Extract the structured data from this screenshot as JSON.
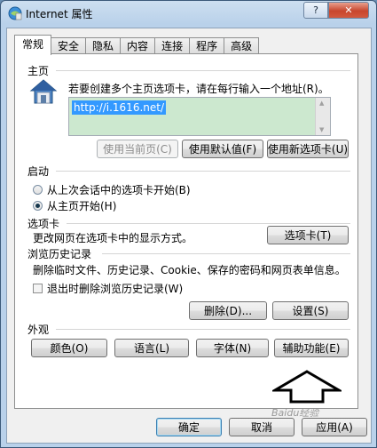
{
  "window": {
    "title": "Internet 属性",
    "help_label": "?",
    "close_label": "✕"
  },
  "tabs": [
    {
      "label": "常规"
    },
    {
      "label": "安全"
    },
    {
      "label": "隐私"
    },
    {
      "label": "内容"
    },
    {
      "label": "连接"
    },
    {
      "label": "程序"
    },
    {
      "label": "高级"
    }
  ],
  "homepage": {
    "title": "主页",
    "description": "若要创建多个主页选项卡，请在每行输入一个地址(R)。",
    "url": "http://i.1616.net/",
    "use_current_label": "使用当前页(C)",
    "use_default_label": "使用默认值(F)",
    "use_new_tab_label": "使用新选项卡(U)"
  },
  "startup": {
    "title": "启动",
    "option_last_session": "从上次会话中的选项卡开始(B)",
    "option_homepage": "从主页开始(H)",
    "selected": "homepage"
  },
  "tabs_section": {
    "title": "选项卡",
    "description": "更改网页在选项卡中的显示方式。",
    "button_label": "选项卡(T)"
  },
  "history": {
    "title": "浏览历史记录",
    "description": "删除临时文件、历史记录、Cookie、保存的密码和网页表单信息。",
    "delete_on_exit_label": "退出时删除浏览历史记录(W)",
    "delete_on_exit_checked": false,
    "delete_label": "删除(D)...",
    "settings_label": "设置(S)"
  },
  "appearance": {
    "title": "外观",
    "colors_label": "颜色(O)",
    "languages_label": "语言(L)",
    "fonts_label": "字体(N)",
    "accessibility_label": "辅助功能(E)"
  },
  "footer": {
    "ok_label": "确定",
    "cancel_label": "取消",
    "apply_label": "应用(A)"
  },
  "watermark": "Baidu经验"
}
